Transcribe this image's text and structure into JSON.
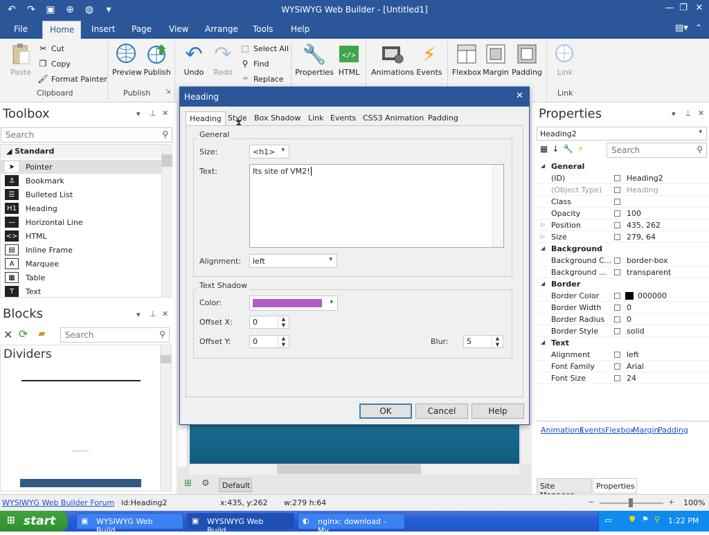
{
  "app": {
    "title": "WYSIWYG Web Builder - [Untitled1]"
  },
  "ribbon_tabs": [
    "File",
    "Home",
    "Insert",
    "Page",
    "View",
    "Arrange",
    "Tools",
    "Help"
  ],
  "ribbon": {
    "paste": "Paste",
    "cut": "Cut",
    "copy": "Copy",
    "format_painter": "Format Painter",
    "clipboard": "Clipboard",
    "preview": "Preview",
    "publish_btn": "Publish",
    "publish_group": "Publish",
    "undo": "Undo",
    "redo": "Redo",
    "select_all": "Select All",
    "find": "Find",
    "replace": "Replace",
    "properties": "Properties",
    "html": "HTML",
    "animations": "Animations",
    "events": "Events",
    "flexbox": "Flexbox",
    "margin": "Margin",
    "padding": "Padding",
    "link": "Link",
    "link_group": "Link"
  },
  "toolbox": {
    "title": "Toolbox",
    "search_placeholder": "Search",
    "section": "Standard",
    "items": [
      "Pointer",
      "Bookmark",
      "Bulleted List",
      "Heading",
      "Horizontal Line",
      "HTML",
      "Inline Frame",
      "Marquee",
      "Table",
      "Text"
    ]
  },
  "blocks": {
    "title": "Blocks",
    "search_placeholder": "Search",
    "category": "Dividers"
  },
  "dialog": {
    "title": "Heading",
    "tabs": [
      "Heading",
      "Style",
      "Box Shadow",
      "Link",
      "Events",
      "CSS3 Animation",
      "Padding"
    ],
    "general_legend": "General",
    "size_label": "Size:",
    "size_value": "<h1>",
    "text_label": "Text:",
    "text_value": "Its site of VM2!",
    "alignment_label": "Alignment:",
    "alignment_value": "left",
    "shadow_legend": "Text Shadow",
    "color_label": "Color:",
    "color_value": "#b35cc8",
    "offsetx_label": "Offset X:",
    "offsetx_value": "0",
    "offsety_label": "Offset Y:",
    "offsety_value": "0",
    "blur_label": "Blur:",
    "blur_value": "5",
    "ok": "OK",
    "cancel": "Cancel",
    "help": "Help"
  },
  "canvas": {
    "page_tab": "Default"
  },
  "properties": {
    "title": "Properties",
    "selected": "Heading2",
    "search_placeholder": "Search",
    "rows": [
      {
        "type": "group",
        "name": "General"
      },
      {
        "name": "(ID)",
        "value": "Heading2"
      },
      {
        "name": "(Object Type)",
        "value": "Heading",
        "muted": true
      },
      {
        "name": "Class",
        "value": ""
      },
      {
        "name": "Opacity",
        "value": "100"
      },
      {
        "name": "Position",
        "value": "435, 262",
        "expandable": true
      },
      {
        "name": "Size",
        "value": "279, 64",
        "expandable": true
      },
      {
        "type": "group",
        "name": "Background"
      },
      {
        "name": "Background C...",
        "value": "border-box"
      },
      {
        "name": "Background ...",
        "value": "transparent"
      },
      {
        "type": "group",
        "name": "Border"
      },
      {
        "name": "Border Color",
        "value": "000000",
        "swatch": "#000000"
      },
      {
        "name": "Border Width",
        "value": "0"
      },
      {
        "name": "Border Radius",
        "value": "0"
      },
      {
        "name": "Border Style",
        "value": "solid"
      },
      {
        "type": "group",
        "name": "Text"
      },
      {
        "name": "Alignment",
        "value": "left"
      },
      {
        "name": "Font Family",
        "value": "Arial"
      },
      {
        "name": "Font Size",
        "value": "24"
      }
    ],
    "links": [
      "Animations",
      "Events",
      "Flexbox",
      "Margin",
      "Padding"
    ],
    "bottom_tabs": [
      "Site Manager",
      "Properties"
    ]
  },
  "status": {
    "forum": "WYSIWYG Web Builder Forum",
    "id": "id:Heading2",
    "pos": "x:435, y:262",
    "size": "w:279 h:64",
    "zoom": "100%"
  },
  "taskbar": {
    "start": "start",
    "items": [
      "WYSIWYG Web Build...",
      "WYSIWYG Web Build...",
      "nginx: download - My..."
    ],
    "clock": "1:22 PM"
  }
}
